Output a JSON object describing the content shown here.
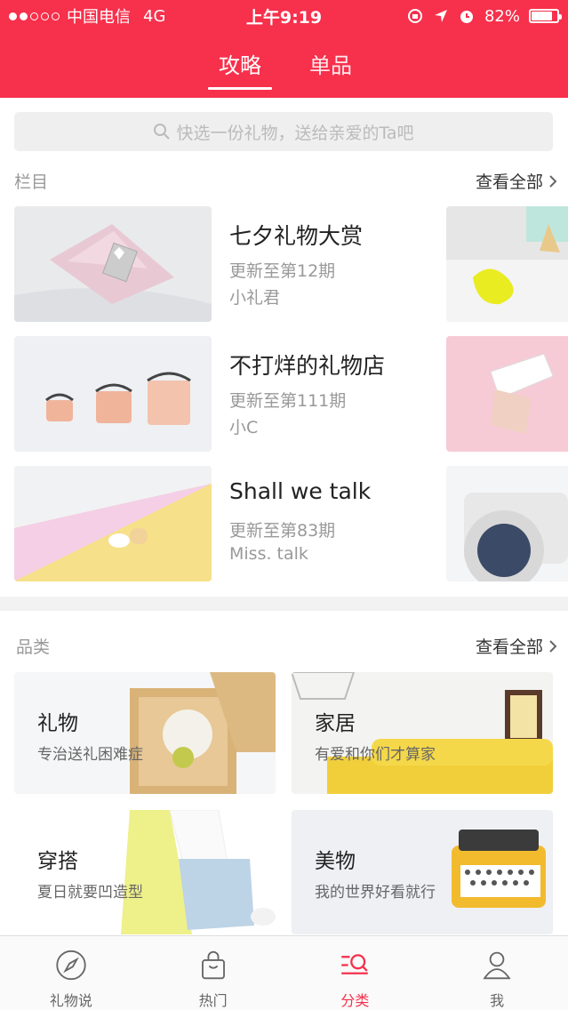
{
  "status_bar": {
    "carrier": "中国电信",
    "network": "4G",
    "time": "上午9:19",
    "battery": "82%",
    "battery_level": 0.82
  },
  "tabs": [
    {
      "label": "攻略",
      "active": true
    },
    {
      "label": "单品",
      "active": false
    }
  ],
  "search": {
    "placeholder": "快选一份礼物，送给亲爱的Ta吧"
  },
  "columns_section": {
    "title": "栏目",
    "view_all": "查看全部",
    "items": [
      {
        "title": "七夕礼物大赏",
        "update": "更新至第12期",
        "author": "小礼君"
      },
      {
        "title": "不打烊的礼物店",
        "update": "更新至第111期",
        "author": "小C"
      },
      {
        "title": "Shall we talk",
        "update": "更新至第83期",
        "author": "Miss. talk"
      }
    ]
  },
  "category_section": {
    "title": "品类",
    "view_all": "查看全部",
    "items": [
      {
        "name": "礼物",
        "desc": "专治送礼困难症"
      },
      {
        "name": "家居",
        "desc": "有爱和你们才算家"
      },
      {
        "name": "穿搭",
        "desc": "夏日就要凹造型"
      },
      {
        "name": "美物",
        "desc": "我的世界好看就行"
      }
    ]
  },
  "bottom_nav": [
    {
      "label": "礼物说",
      "icon": "compass-icon",
      "active": false
    },
    {
      "label": "热门",
      "icon": "shopping-bag-icon",
      "active": false
    },
    {
      "label": "分类",
      "icon": "category-search-icon",
      "active": true
    },
    {
      "label": "我",
      "icon": "person-icon",
      "active": false
    }
  ],
  "colors": {
    "brand": "#f7304c"
  }
}
